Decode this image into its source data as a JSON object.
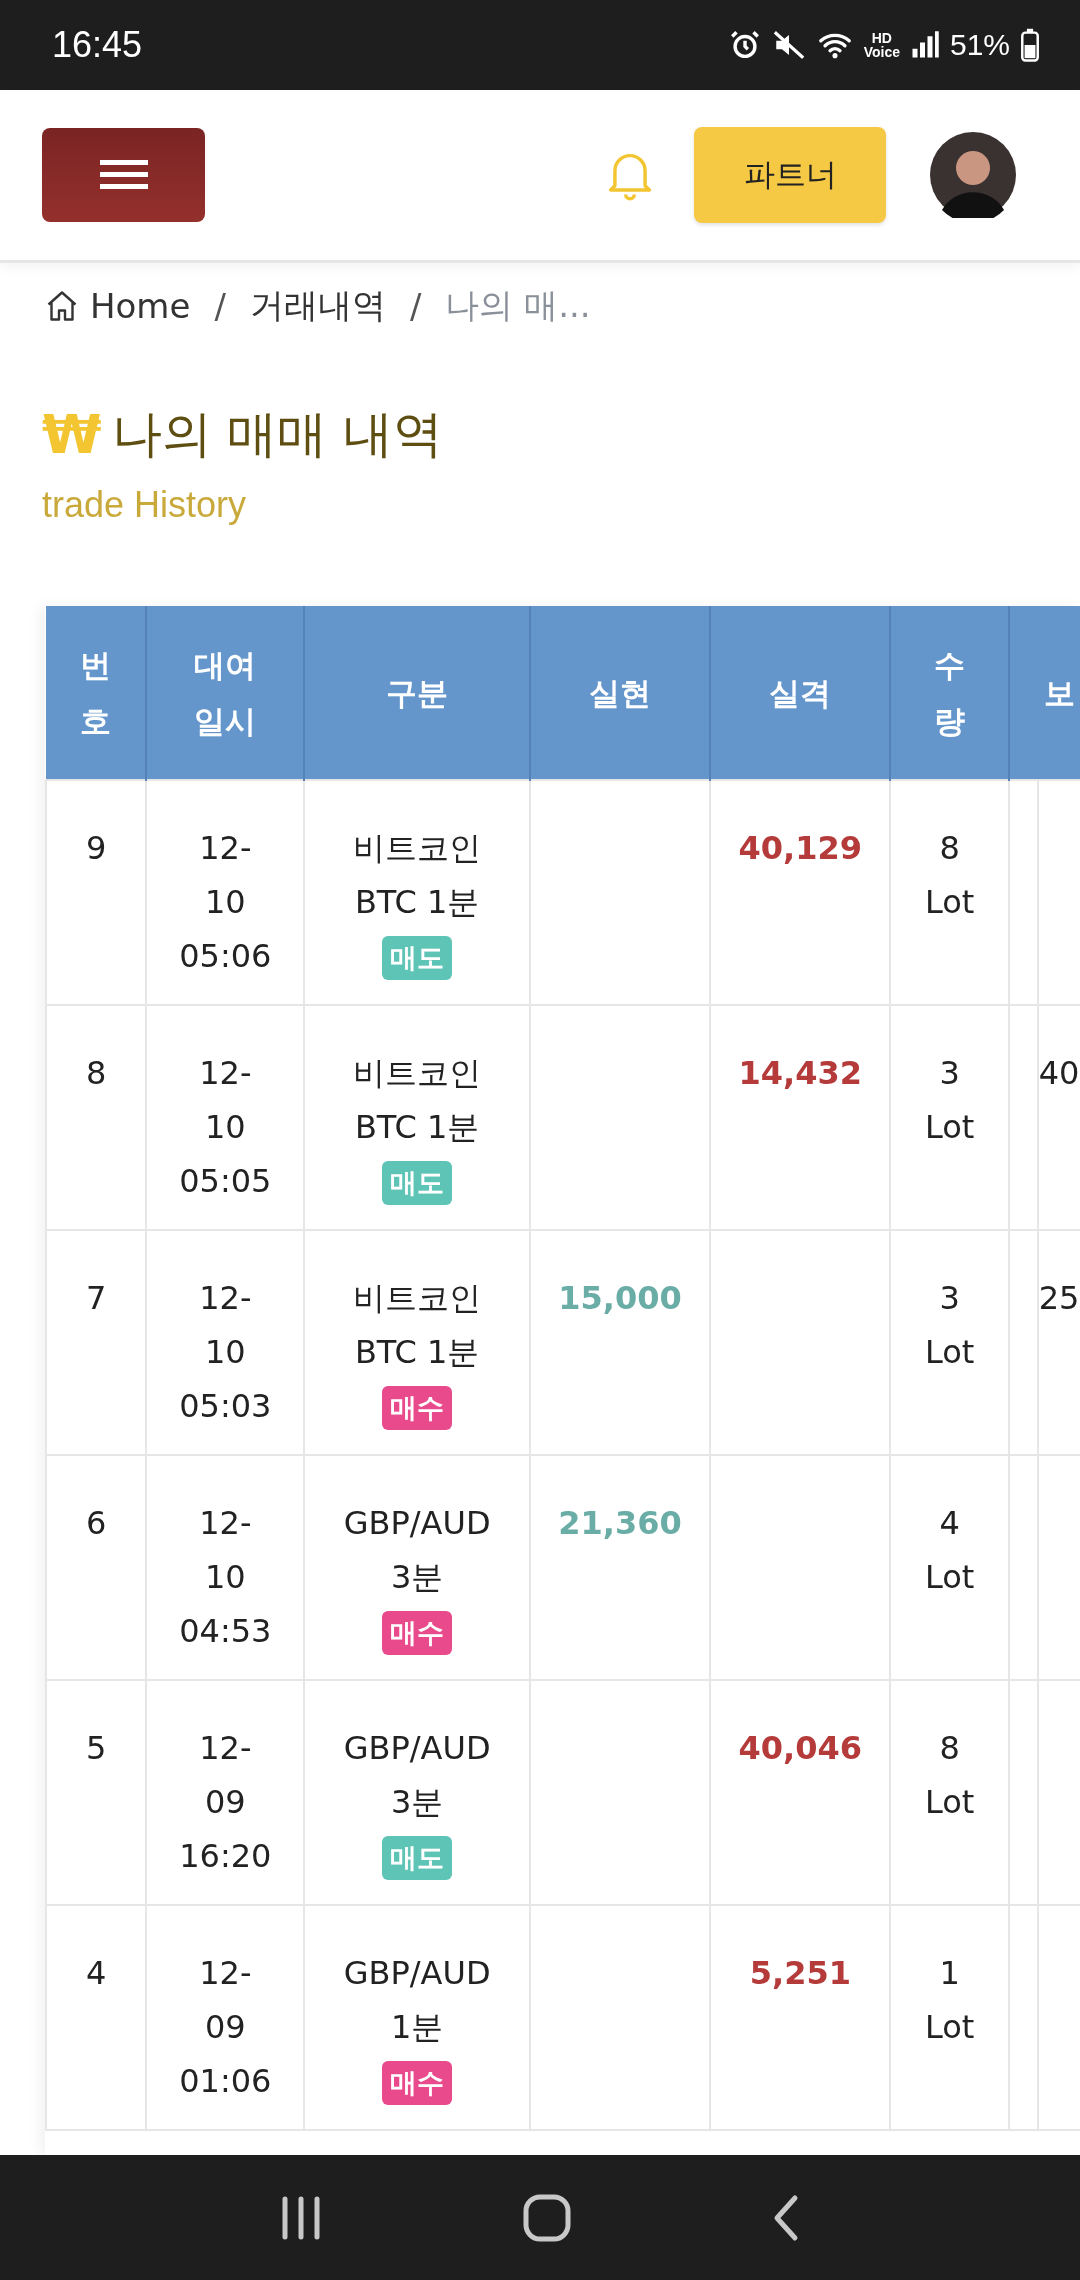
{
  "status_bar": {
    "time": "16:45",
    "hd_voice": "HD Voice",
    "battery": "51%"
  },
  "header": {
    "partner_button": "파트너"
  },
  "breadcrumb": {
    "separator": "/",
    "items": [
      {
        "label": "Home",
        "current": false
      },
      {
        "label": "거래내역",
        "current": false
      },
      {
        "label": "나의 매...",
        "current": true
      }
    ]
  },
  "page": {
    "currency_symbol": "₩",
    "title": "나의 매매 내역",
    "subtitle": "trade History"
  },
  "table": {
    "columns": [
      "번호",
      "대여일시",
      "구분",
      "실현",
      "실격",
      "수량",
      "보"
    ],
    "rows": [
      {
        "number": "9",
        "date": "12-10 05:06",
        "product": "비트코인 BTC 1분",
        "side": {
          "label": "매도",
          "kind": "sell"
        },
        "price": "40,129",
        "quantity": "8 Lot"
      },
      {
        "number": "8",
        "date": "12-10 05:05",
        "product": "비트코인 BTC 1분",
        "side": {
          "label": "매도",
          "kind": "sell"
        },
        "price": "14,432",
        "quantity": "3 Lot",
        "column_7": "40"
      },
      {
        "number": "7",
        "date": "12-10 05:03",
        "product": "비트코인 BTC 1분",
        "side": {
          "label": "매수",
          "kind": "buy"
        },
        "realized": "15,000",
        "quantity": "3 Lot",
        "column_7": "25"
      },
      {
        "number": "6",
        "date": "12-10 04:53",
        "product": "GBP/AUD 3분",
        "side": {
          "label": "매수",
          "kind": "buy"
        },
        "realized": "21,360",
        "quantity": "4 Lot"
      },
      {
        "number": "5",
        "date": "12-09 16:20",
        "product": "GBP/AUD 3분",
        "side": {
          "label": "매도",
          "kind": "sell"
        },
        "price": "40,046",
        "quantity": "8 Lot"
      },
      {
        "number": "4",
        "date": "12-09 01:06",
        "product": "GBP/AUD 1분",
        "side": {
          "label": "매수",
          "kind": "buy"
        },
        "price": "5,251",
        "quantity": "1 Lot"
      }
    ]
  }
}
